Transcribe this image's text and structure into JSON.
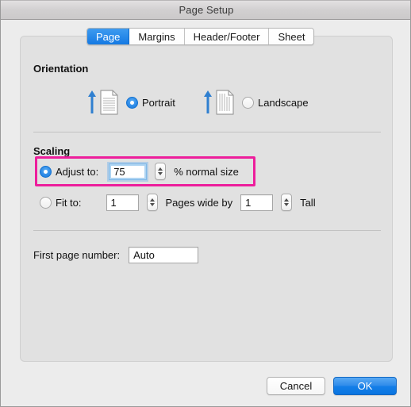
{
  "window": {
    "title": "Page Setup"
  },
  "tabs": [
    {
      "label": "Page",
      "name": "tab-page",
      "active": true
    },
    {
      "label": "Margins",
      "name": "tab-margins",
      "active": false
    },
    {
      "label": "Header/Footer",
      "name": "tab-header-footer",
      "active": false
    },
    {
      "label": "Sheet",
      "name": "tab-sheet",
      "active": false
    }
  ],
  "orientation": {
    "title": "Orientation",
    "options": [
      {
        "label": "Portrait",
        "selected": true,
        "icon": "portrait-page-icon"
      },
      {
        "label": "Landscape",
        "selected": false,
        "icon": "landscape-page-icon"
      }
    ]
  },
  "scaling": {
    "title": "Scaling",
    "adjust_to": {
      "label": "Adjust to:",
      "selected": true,
      "value": "75",
      "suffix": "% normal size",
      "stepper": "stepper-icon",
      "highlighted": true
    },
    "fit_to": {
      "label": "Fit to:",
      "selected": false,
      "pages_wide": "1",
      "middle_label": "Pages wide by",
      "pages_tall": "1",
      "tall_label": "Tall"
    }
  },
  "first_page": {
    "label": "First page number:",
    "value": "Auto",
    "placeholder": "Auto"
  },
  "buttons": {
    "cancel": "Cancel",
    "ok": "OK"
  },
  "colors": {
    "accent_blue": "#1479e3",
    "highlight_magenta": "#ed1e9c",
    "panel_gray": "#e1e1e1",
    "window_gray": "#ececec"
  }
}
